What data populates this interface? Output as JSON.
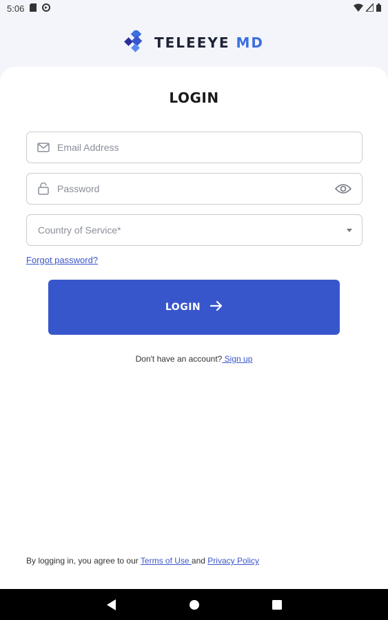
{
  "status_bar": {
    "time": "5:06"
  },
  "brand": {
    "name_main": "TELEEYE",
    "name_accent": "MD"
  },
  "login": {
    "title": "LOGIN",
    "email_placeholder": "Email Address",
    "password_placeholder": "Password",
    "country_placeholder": "Country of Service*",
    "forgot_password": "Forgot password?",
    "button_label": "LOGIN",
    "no_account_text": "Don't have an account?",
    "sign_up": " Sign up"
  },
  "footer": {
    "agree_text": "By logging in, you agree to our",
    "terms_link": "Terms of Use ",
    "and_text": "and",
    "privacy_link": "Privacy Policy "
  },
  "colors": {
    "primary": "#3856cc",
    "accent": "#3d6fe0",
    "logo_dark": "#2b2f9a"
  },
  "icons": [
    "sd-card-icon",
    "sync-icon",
    "wifi-icon",
    "signal-icon",
    "battery-icon",
    "mail-icon",
    "lock-icon",
    "eye-icon",
    "chevron-down-icon",
    "arrow-right-icon",
    "back-icon",
    "home-icon",
    "recents-icon"
  ]
}
